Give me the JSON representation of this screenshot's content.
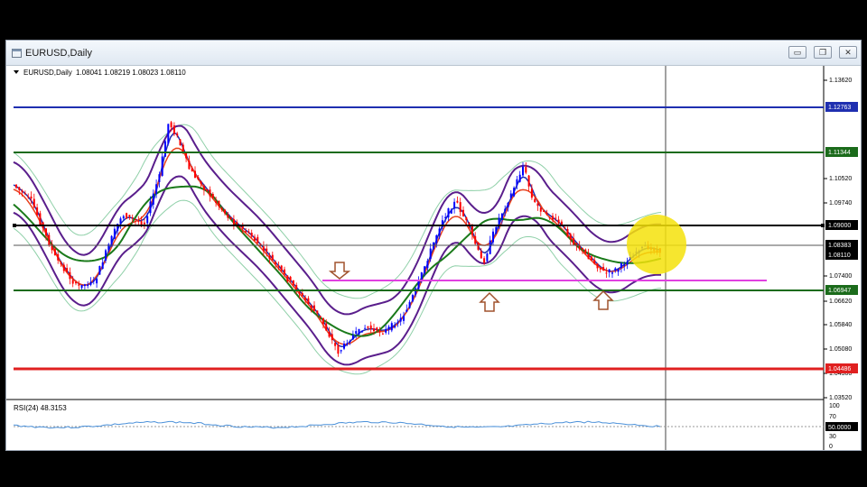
{
  "window": {
    "title": "EURUSD,Daily",
    "buttons": {
      "minimize": "▭",
      "restore": "❐",
      "close": "✕"
    }
  },
  "chart": {
    "info": {
      "symbol_tf": "EURUSD,Daily",
      "ohlc": "1.08041 1.08219 1.08023 1.08110"
    },
    "price_scale": [
      "1.13620",
      "1.10520",
      "1.09740",
      "1.07400",
      "1.06620",
      "1.05840",
      "1.05080",
      "1.04300",
      "1.03520"
    ],
    "level_labels": [
      {
        "text": "1.12763",
        "color": "#1f2fb0"
      },
      {
        "text": "1.11344",
        "color": "#1b6b1b"
      },
      {
        "text": "1.09000",
        "color": "#000000"
      },
      {
        "text": "1.08383",
        "color": "#000000"
      },
      {
        "text": "1.08110",
        "color": "#000000"
      },
      {
        "text": "1.06947",
        "color": "#1b6b1b"
      },
      {
        "text": "1.04486",
        "color": "#e02020"
      }
    ],
    "rsi": {
      "label": "RSI(24) 48.3153",
      "scale": [
        "100",
        "70",
        "30",
        "0"
      ],
      "level_label": "50.0000"
    },
    "colors": {
      "bull_candle": "#0000ff",
      "bear_candle": "#ff0000",
      "ma_blue": "#1f2fb0",
      "ma_red": "#e8401c",
      "ma_green": "#1a7a1a",
      "envelope_purple": "#5a1e8c",
      "envelope_light": "#8fd0a8",
      "support_pink": "#e040e0",
      "highlight_yellow": "#f5e20a",
      "arrow_brown": "#a0522d"
    }
  }
}
